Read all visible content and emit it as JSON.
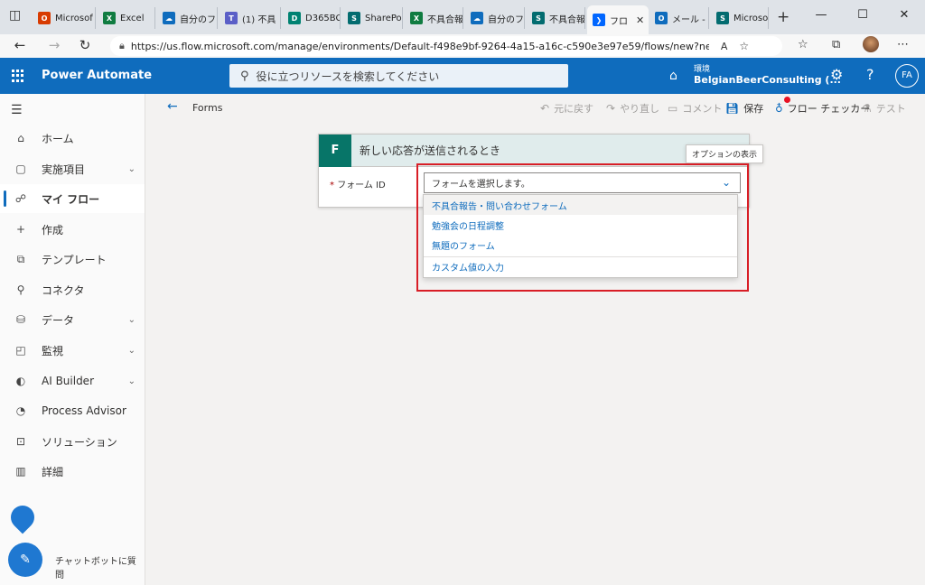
{
  "browser": {
    "tabs": [
      {
        "label": "Microsof",
        "icon": "office-icon",
        "color": "#d83b01",
        "glyph": "O"
      },
      {
        "label": "Excel",
        "icon": "excel-icon",
        "color": "#107c41",
        "glyph": "X"
      },
      {
        "label": "自分のファ",
        "icon": "onedrive-icon",
        "color": "#0f6cbd",
        "glyph": "☁"
      },
      {
        "label": "(1) 不具",
        "icon": "teams-icon",
        "color": "#5b5fc7",
        "glyph": "T"
      },
      {
        "label": "D365BC",
        "icon": "dynamics-icon",
        "color": "#008272",
        "glyph": "D"
      },
      {
        "label": "SharePo",
        "icon": "sharepoint-icon",
        "color": "#036c70",
        "glyph": "S"
      },
      {
        "label": "不具合報",
        "icon": "excel-icon",
        "color": "#107c41",
        "glyph": "X"
      },
      {
        "label": "自分のファ",
        "icon": "onedrive-icon",
        "color": "#0f6cbd",
        "glyph": "☁"
      },
      {
        "label": "不具合報",
        "icon": "sharepoint-icon",
        "color": "#036c70",
        "glyph": "S"
      },
      {
        "label": "フロ",
        "icon": "power-automate-icon",
        "color": "#0066ff",
        "glyph": "❯"
      },
      {
        "label": "メール - Fi",
        "icon": "outlook-icon",
        "color": "#0f6cbd",
        "glyph": "O"
      },
      {
        "label": "Microsof",
        "icon": "sharepoint-icon",
        "color": "#036c70",
        "glyph": "S"
      }
    ],
    "url": "https://us.flow.microsoft.com/manage/environments/Default-f498e9bf-9264-4a15-a16c-c590e3e97e59/flows/new?newFlowName..."
  },
  "header": {
    "brand": "Power Automate",
    "search_placeholder": "役に立つリソースを検索してください",
    "env_label": "環境",
    "env_name": "BelgianBeerConsulting (...",
    "avatar": "FA"
  },
  "nav": {
    "items": [
      {
        "label": "ホーム",
        "icon": "home-icon",
        "glyph": "⌂",
        "chevron": false
      },
      {
        "label": "実施項目",
        "icon": "clipboard-icon",
        "glyph": "▢",
        "chevron": true
      },
      {
        "label": "マイ フロー",
        "icon": "flow-icon",
        "glyph": "☍",
        "chevron": false
      },
      {
        "label": "作成",
        "icon": "plus-icon",
        "glyph": "+",
        "chevron": false
      },
      {
        "label": "テンプレート",
        "icon": "template-icon",
        "glyph": "⧉",
        "chevron": false
      },
      {
        "label": "コネクタ",
        "icon": "connector-icon",
        "glyph": "⚲",
        "chevron": false
      },
      {
        "label": "データ",
        "icon": "database-icon",
        "glyph": "⛁",
        "chevron": true
      },
      {
        "label": "監視",
        "icon": "monitor-icon",
        "glyph": "◰",
        "chevron": true
      },
      {
        "label": "AI Builder",
        "icon": "ai-builder-icon",
        "glyph": "◐",
        "chevron": true
      },
      {
        "label": "Process Advisor",
        "icon": "process-advisor-icon",
        "glyph": "◔",
        "chevron": false
      },
      {
        "label": "ソリューション",
        "icon": "solution-icon",
        "glyph": "⊡",
        "chevron": false
      },
      {
        "label": "詳細",
        "icon": "book-icon",
        "glyph": "▥",
        "chevron": false
      }
    ],
    "chatbot": "チャットボットに質問"
  },
  "cmdbar": {
    "flow_name": "Forms",
    "undo": "元に戻す",
    "redo": "やり直し",
    "comment": "コメント",
    "save": "保存",
    "checker": "フロー チェッカー",
    "test": "テスト"
  },
  "card": {
    "title": "新しい応答が送信されるとき",
    "field_label": "フォーム ID",
    "required_mark": "*",
    "select_placeholder": "フォームを選択します。",
    "tooltip": "オプションの表示"
  },
  "dropdown": {
    "options": [
      "不具合報告・問い合わせフォーム",
      "勉強会の日程調整",
      "無題のフォーム"
    ],
    "custom": "カスタム値の入力"
  }
}
